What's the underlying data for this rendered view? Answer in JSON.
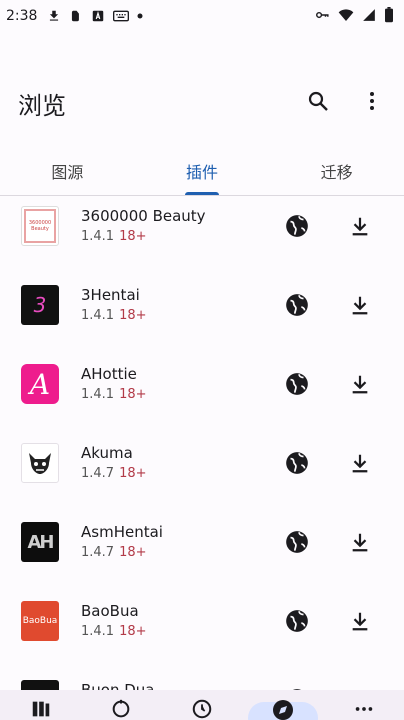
{
  "status_bar": {
    "time": "2:38"
  },
  "app_bar": {
    "title": "浏览"
  },
  "tabs": [
    {
      "label": "图源",
      "active": false
    },
    {
      "label": "插件",
      "active": true
    },
    {
      "label": "迁移",
      "active": false
    }
  ],
  "extensions": [
    {
      "name": "3600000 Beauty",
      "version": "1.4.1",
      "nsfw": "18+"
    },
    {
      "name": "3Hentai",
      "version": "1.4.1",
      "nsfw": "18+"
    },
    {
      "name": "AHottie",
      "version": "1.4.1",
      "nsfw": "18+"
    },
    {
      "name": "Akuma",
      "version": "1.4.7",
      "nsfw": "18+"
    },
    {
      "name": "AsmHentai",
      "version": "1.4.7",
      "nsfw": "18+"
    },
    {
      "name": "BaoBua",
      "version": "1.4.1",
      "nsfw": "18+"
    },
    {
      "name": "Buon Dua",
      "version": "",
      "nsfw": ""
    }
  ],
  "thumb_texts": {
    "beauty_top": "3600000",
    "beauty_bottom": "Beauty",
    "hentai3": "3",
    "ahottie": "A",
    "asm": "AH",
    "baobua": "BaoBua"
  },
  "colors": {
    "accent": "#1f5fb0",
    "nsfw": "#b23a48",
    "ahottie_bg": "#ee1c8d",
    "baobua_bg": "#e04a2f"
  }
}
